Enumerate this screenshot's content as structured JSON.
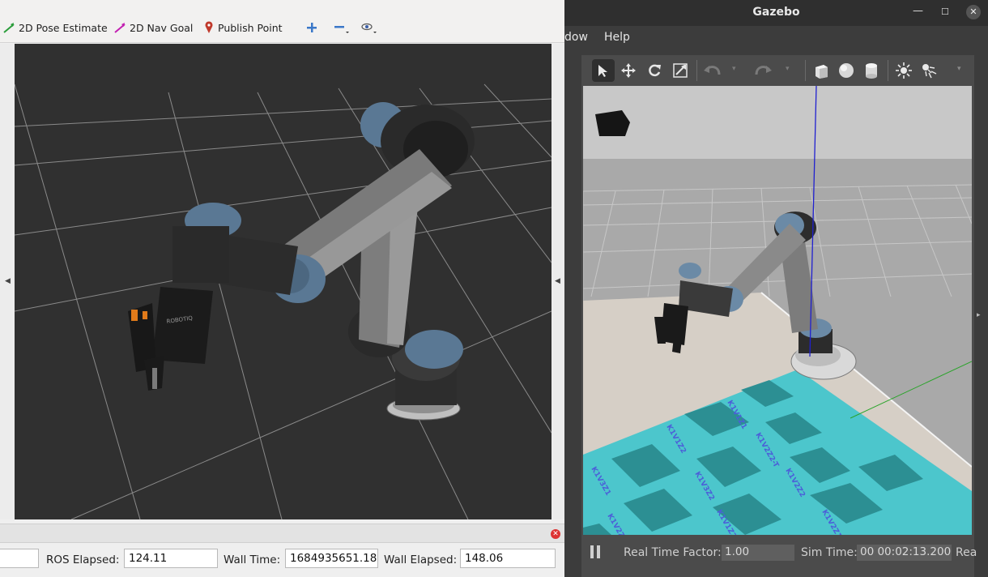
{
  "rviz": {
    "tools": [
      {
        "label": "2D Pose Estimate",
        "icon": "pose-arrow-icon"
      },
      {
        "label": "2D Nav Goal",
        "icon": "nav-goal-arrow-icon"
      },
      {
        "label": "Publish Point",
        "icon": "map-pin-icon"
      }
    ],
    "view_icons": [
      "plus-icon",
      "minus-icon",
      "eye-icon"
    ],
    "time": {
      "ros_elapsed_label": "ROS Elapsed:",
      "ros_elapsed_value": "124.11",
      "wall_time_label": "Wall Time:",
      "wall_time_value": "1684935651.18",
      "wall_elapsed_label": "Wall Elapsed:",
      "wall_elapsed_value": "148.06"
    },
    "gripper_brand": "ROBOTIQ"
  },
  "gazebo": {
    "title": "Gazebo",
    "menu": [
      "dow",
      "Help"
    ],
    "status": {
      "rtf_label": "Real Time Factor:",
      "rtf_value": "1.00",
      "sim_time_label": "Sim Time:",
      "sim_time_value": "00 00:02:13.200",
      "real_label_partial": "Rea"
    },
    "colors": {
      "sky": "#cfcfcf",
      "mat": "#4cc6cc",
      "pad": "#2c8f93",
      "table": "#d6cfc6"
    },
    "mat_labels": [
      "K1V1Z1",
      "K1V1Z2",
      "K1V2Z2-T",
      "K1V3Z1",
      "K1V3Z2",
      "K1V2Z2",
      "K1V2Z2-1",
      "K1V1Z2-2",
      "K1V2Z1",
      "K1V3Z3"
    ]
  }
}
